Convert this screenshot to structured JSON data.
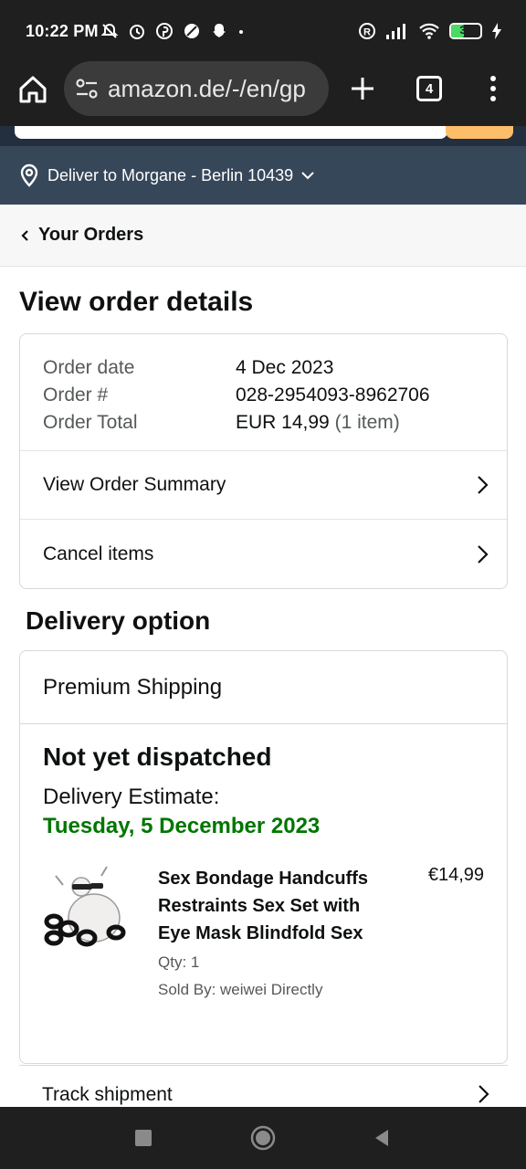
{
  "status_bar": {
    "time": "10:22 PM",
    "battery_level": "35",
    "icons": [
      "mute-icon",
      "alarm-icon",
      "pinterest-icon",
      "app-icon",
      "snapchat-icon",
      "dot-icon",
      "registered-icon",
      "signal-icon",
      "wifi-icon",
      "battery-icon",
      "charging-icon"
    ]
  },
  "browser": {
    "url": "amazon.de/-/en/gp",
    "tab_count": "4"
  },
  "location": {
    "deliver_to": "Deliver to Morgane - Berlin 10439"
  },
  "breadcrumb": {
    "label": "Your Orders"
  },
  "page": {
    "title": "View order details"
  },
  "order": {
    "date_label": "Order date",
    "date_value": "4 Dec 2023",
    "number_label": "Order #",
    "number_value": "028-2954093-8962706",
    "total_label": "Order Total",
    "total_value": "EUR 14,99",
    "total_items": "(1 item)",
    "summary_link": "View Order Summary",
    "cancel_link": "Cancel items"
  },
  "delivery": {
    "section_title": "Delivery option",
    "method": "Premium Shipping",
    "status": "Not yet dispatched",
    "estimate_label": "Delivery Estimate:",
    "estimate_date": "Tuesday, 5 December 2023",
    "track_link": "Track shipment"
  },
  "item": {
    "name": "Sex Bondage Handcuffs Restraints Sex Set with Eye Mask Blindfold Sex",
    "price": "€14,99",
    "qty": "Qty: 1",
    "seller": "Sold By: weiwei Directly"
  },
  "colors": {
    "amazon_dark": "#232f3e",
    "deliver_bar": "#37475a",
    "estimate_green": "#007600",
    "search_button": "#febd69"
  }
}
